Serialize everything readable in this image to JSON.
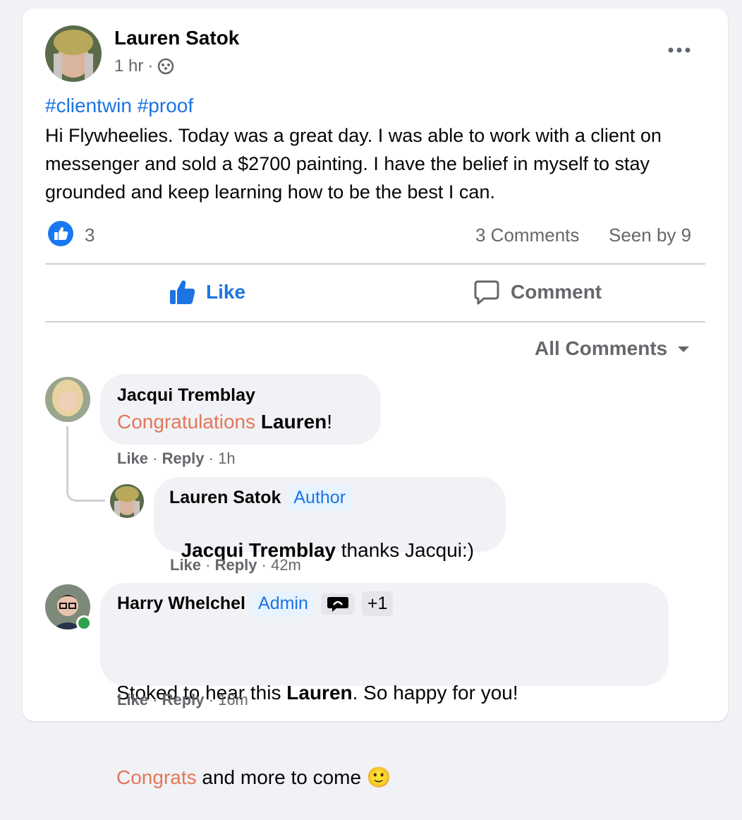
{
  "post": {
    "author": "Lauren Satok",
    "time": "1 hr",
    "hashtags": "#clientwin #proof",
    "body": "Hi Flywheelies. Today was a great day. I was able to work with a client on messenger and sold  a  $2700 painting. I have the belief in myself to stay grounded and keep learning how to be the best I can.",
    "like_count": "3",
    "comments_count": "3 Comments",
    "seen_by": "Seen by 9",
    "like_label": "Like",
    "comment_label": "Comment",
    "sort_label": "All Comments"
  },
  "comments": [
    {
      "author": "Jacqui Tremblay",
      "text_highlight": "Congratulations",
      "text_bold": "Lauren",
      "text_tail": "!",
      "like": "Like",
      "reply": "Reply",
      "time": "1h"
    },
    {
      "author": "Lauren Satok",
      "badge": "Author",
      "mention": "Jacqui Tremblay",
      "text": " thanks Jacqui:)",
      "like": "Like",
      "reply": "Reply",
      "time": "42m"
    },
    {
      "author": "Harry Whelchel",
      "badge": "Admin",
      "extra_badge": "+1",
      "line1_a": "Stoked to hear this ",
      "line1_bold": "Lauren",
      "line1_b": ". So happy for you!",
      "line2_highlight": "Congrats",
      "line2_tail": " and more to come ",
      "emoji": "🙂",
      "like": "Like",
      "reply": "Reply",
      "time": "16m"
    }
  ],
  "colors": {
    "accent": "#1b74e4",
    "highlight": "#e4775a",
    "online": "#31a24c"
  },
  "icons": [
    "more-icon",
    "group-privacy-icon",
    "like-reaction-icon",
    "like-thumb-icon",
    "comment-icon",
    "dropdown-caret-icon",
    "badge-icon"
  ]
}
